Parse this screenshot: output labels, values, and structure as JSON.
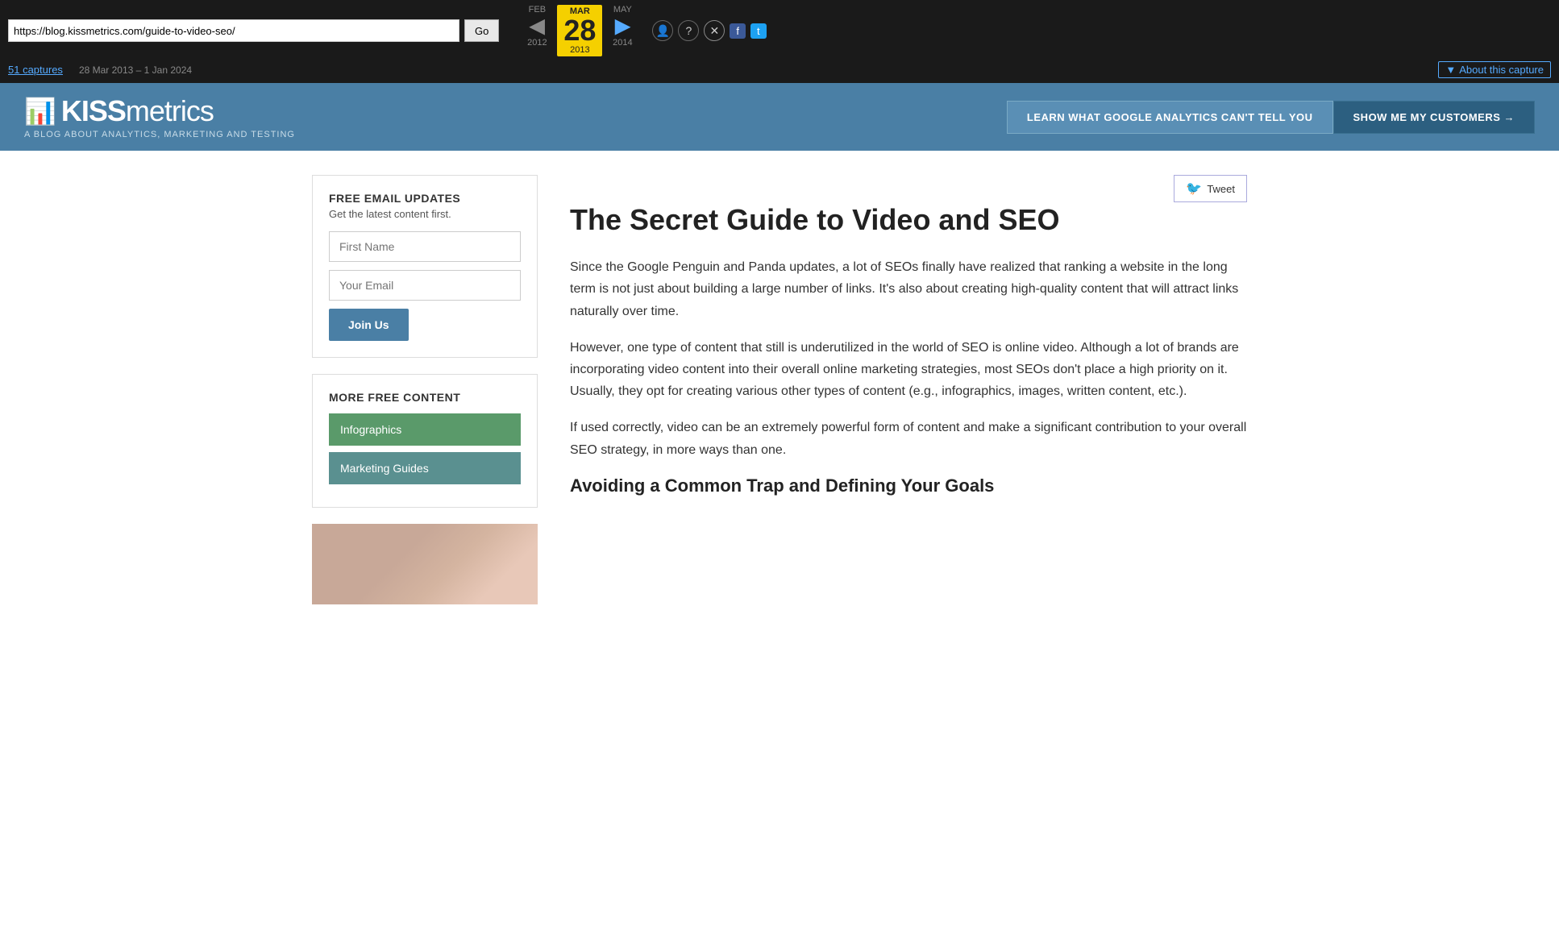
{
  "wayback": {
    "url": "https://blog.kissmetrics.com/guide-to-video-seo/",
    "go_label": "Go",
    "captures_label": "51 captures",
    "captures_date": "28 Mar 2013 – 1 Jan 2024",
    "months": [
      {
        "label": "FEB",
        "year": "2012",
        "active": false
      },
      {
        "label": "MAR",
        "day": "28",
        "year": "2013",
        "active": true
      },
      {
        "label": "MAY",
        "year": "2014",
        "active": false
      }
    ],
    "about_capture": "About this capture"
  },
  "site": {
    "logo_text_bold": "KISS",
    "logo_text_thin": "metrics",
    "tagline": "A BLOG ABOUT ANALYTICS, MARKETING AND TESTING",
    "cta_learn": "LEARN WHAT GOOGLE ANALYTICS CAN'T TELL YOU",
    "cta_show": "SHOW ME MY CUSTOMERS →"
  },
  "sidebar": {
    "email_section": {
      "title": "FREE EMAIL UPDATES",
      "subtitle": "Get the latest content first.",
      "first_name_placeholder": "First Name",
      "email_placeholder": "Your Email",
      "join_label": "Join Us"
    },
    "more_content": {
      "title": "MORE FREE CONTENT",
      "items": [
        "Infographics",
        "Marketing Guides"
      ]
    }
  },
  "article": {
    "title": "The Secret Guide to Video and SEO",
    "paragraphs": [
      "Since the Google Penguin and Panda updates, a lot of SEOs finally have realized that ranking a website in the long term is not just about building a large number of links. It's also about creating high-quality content that will attract links naturally over time.",
      "However, one type of content that still is underutilized in the world of SEO is online video. Although a lot of brands are incorporating video content into their overall online marketing strategies, most SEOs don't place a high priority on it. Usually, they opt for creating various other types of content (e.g., infographics, images, written content, etc.).",
      "If used correctly, video can be an extremely powerful form of content and make a significant contribution to your overall SEO strategy, in more ways than one."
    ],
    "subheading": "Avoiding a Common Trap and Defining Your Goals",
    "tweet_label": "Tweet"
  }
}
